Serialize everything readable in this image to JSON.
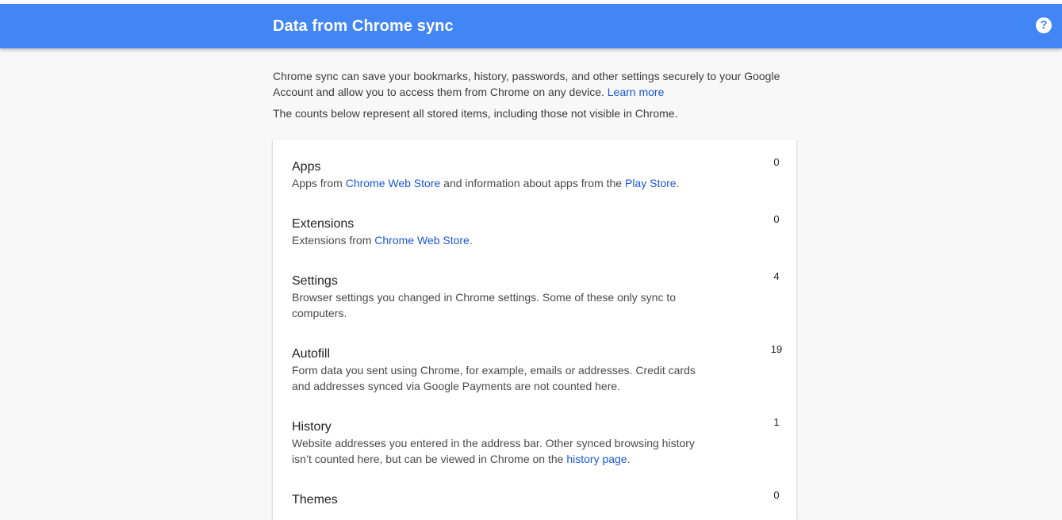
{
  "header": {
    "title": "Data from Chrome sync",
    "help_icon": "help-circle-icon"
  },
  "intro": {
    "line1_text": "Chrome sync can save your bookmarks, history, passwords, and other settings securely to your Google Account and allow you to access them from Chrome on any device. ",
    "learn_more": "Learn more",
    "line2": "The counts below represent all stored items, including those not visible in Chrome."
  },
  "items": [
    {
      "title": "Apps",
      "count": "0",
      "desc_a": "Apps from ",
      "link1": "Chrome Web Store",
      "desc_b": " and information about apps from the ",
      "link2": "Play Store",
      "desc_c": "."
    },
    {
      "title": "Extensions",
      "count": "0",
      "desc_a": "Extensions from ",
      "link1": "Chrome Web Store",
      "desc_b": "."
    },
    {
      "title": "Settings",
      "count": "4",
      "desc": "Browser settings you changed in Chrome settings. Some of these only sync to computers."
    },
    {
      "title": "Autofill",
      "count": "19",
      "desc": "Form data you sent using Chrome, for example, emails or addresses. Credit cards and addresses synced via Google Payments are not counted here."
    },
    {
      "title": "History",
      "count": "1",
      "desc_a": "Website addresses you entered in the address bar. Other synced browsing history isn’t counted here, but can be viewed in Chrome on the ",
      "link1": "history page",
      "desc_b": "."
    },
    {
      "title": "Themes",
      "count": "0"
    }
  ],
  "colors": {
    "header_blue": "#4285f4",
    "link_blue": "#1a57d9",
    "page_bg": "#f8f8f8"
  }
}
